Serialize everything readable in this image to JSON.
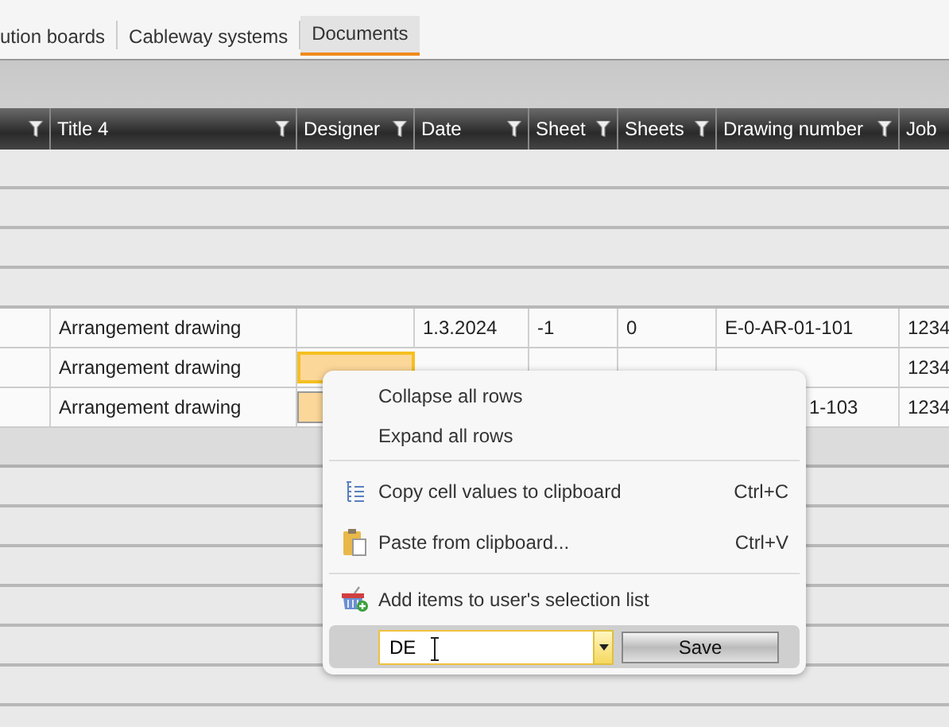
{
  "tabs": [
    {
      "label": "ution boards",
      "selected": false
    },
    {
      "label": "Cableway systems",
      "selected": false
    },
    {
      "label": "Documents",
      "selected": true
    }
  ],
  "table": {
    "columns": [
      {
        "filter": true
      },
      {
        "label": "Title 4",
        "filter": true
      },
      {
        "label": "Designer",
        "filter": true
      },
      {
        "label": "Date",
        "filter": true
      },
      {
        "label": "Sheet",
        "filter": true
      },
      {
        "label": "Sheets",
        "filter": true
      },
      {
        "label": "Drawing number",
        "filter": true
      },
      {
        "label": "Job",
        "filter": false
      }
    ],
    "rows": [
      {
        "cells": [
          null,
          "Arrangement drawing",
          null,
          "1.3.2024",
          "-1",
          "0",
          "E-0-AR-01-101",
          "1234"
        ],
        "designer_highlighted": false
      },
      {
        "cells": [
          null,
          "Arrangement drawing",
          null,
          null,
          null,
          null,
          null,
          "1234"
        ],
        "designer_highlighted": true
      },
      {
        "cells": [
          null,
          "Arrangement drawing",
          null,
          null,
          null,
          null,
          "1-103",
          "1234"
        ],
        "designer_highlighted": true
      }
    ]
  },
  "context_menu": {
    "items": [
      {
        "kind": "plain",
        "label": "Collapse all rows"
      },
      {
        "kind": "plain",
        "label": "Expand all rows"
      },
      {
        "kind": "separator"
      },
      {
        "kind": "copy",
        "label": "Copy cell values to clipboard",
        "shortcut": "Ctrl+C"
      },
      {
        "kind": "paste",
        "label": "Paste from clipboard...",
        "shortcut": "Ctrl+V"
      },
      {
        "kind": "separator"
      },
      {
        "kind": "basket",
        "label": "Add items to user's selection list"
      }
    ],
    "combo_value": "DE",
    "save_button": "Save"
  }
}
